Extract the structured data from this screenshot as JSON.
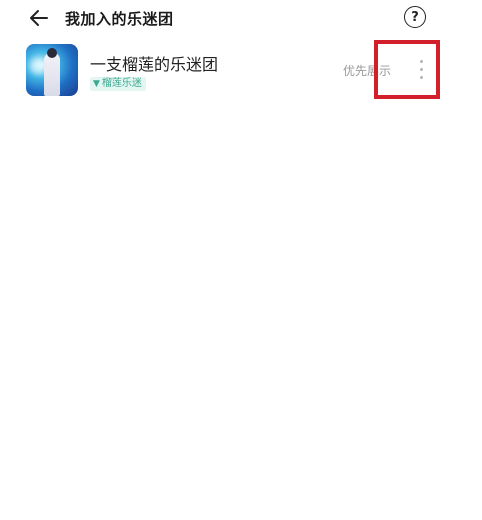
{
  "header": {
    "title": "我加入的乐迷团",
    "back_icon": "arrow-left-icon",
    "help_label": "?",
    "help_icon": "question-circle-icon"
  },
  "clubs": [
    {
      "name": "一支榴莲的乐迷团",
      "tag": "榴莲乐迷",
      "tag_icon": "funnel-icon",
      "tag_color": "#3aa98f",
      "action": "优先展示",
      "more_icon": "more-vertical-icon"
    }
  ],
  "highlight_color": "#d31f2a"
}
